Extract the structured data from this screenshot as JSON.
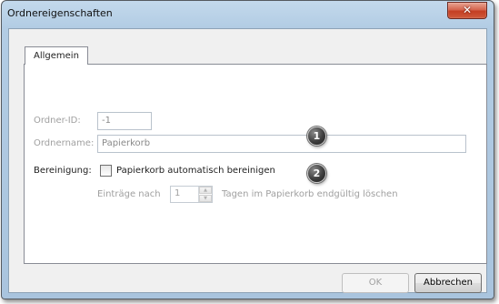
{
  "window": {
    "title": "Ordnereigenschaften",
    "close_glyph": "✕"
  },
  "tabs": [
    {
      "label": "Allgemein",
      "active": true
    }
  ],
  "form": {
    "folder_id": {
      "label": "Ordner-ID:",
      "value": "-1"
    },
    "folder_name": {
      "label": "Ordnername:",
      "value": "Papierkorb"
    },
    "cleanup": {
      "label": "Bereinigung:",
      "checkbox_label": "Papierkorb automatisch bereinigen",
      "checked": false,
      "entries_prefix": "Einträge nach",
      "days_value": "1",
      "entries_suffix": "Tagen im Papierkorb endgültig löschen"
    }
  },
  "callouts": [
    "1",
    "2"
  ],
  "buttons": {
    "ok": "OK",
    "cancel": "Abbrechen"
  },
  "colors": {
    "titlebar": "#b2cce4",
    "close_button": "#c43e22",
    "client": "#f0f0f0"
  }
}
